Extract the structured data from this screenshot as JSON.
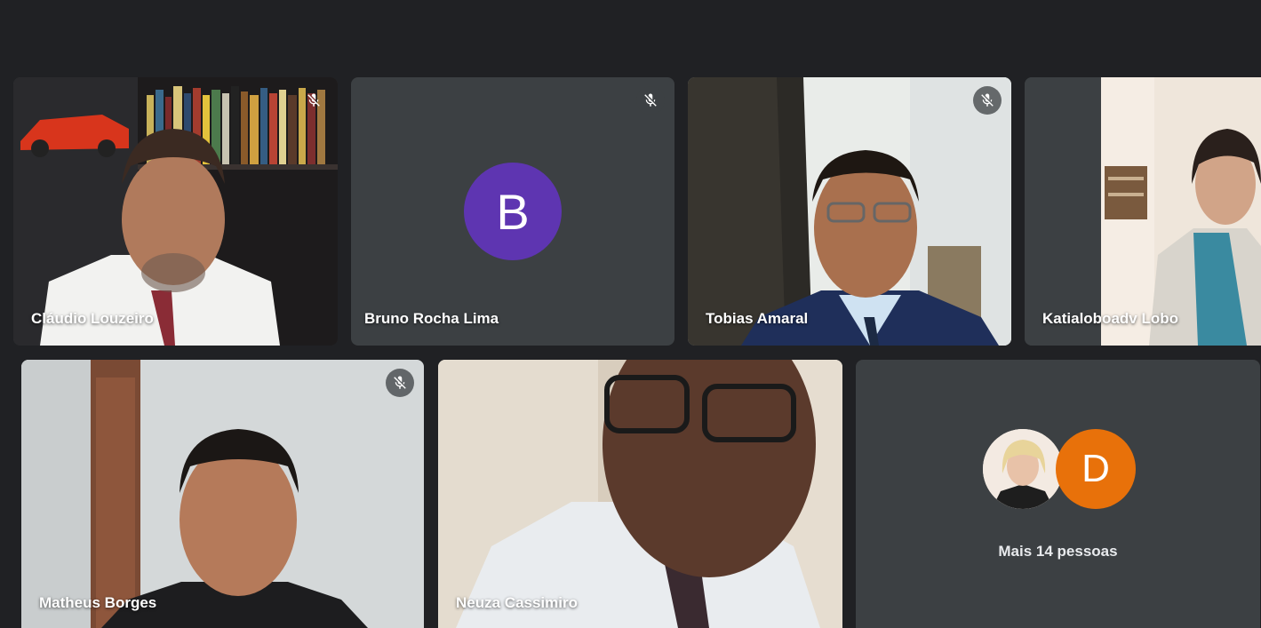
{
  "colors": {
    "background": "#202124",
    "tile": "#3c4043",
    "avatar_b": "#5e35b1",
    "avatar_d": "#e8710a"
  },
  "participants": [
    {
      "name": "Cláudio Louzeiro",
      "muted": true
    },
    {
      "name": "Bruno Rocha Lima",
      "muted": true,
      "avatar_letter": "B"
    },
    {
      "name": "Tobias Amaral",
      "muted": true
    },
    {
      "name": "Katialoboadv Lobo",
      "muted": false
    },
    {
      "name": "Matheus Borges",
      "muted": true
    },
    {
      "name": "Neuza Cassimiro",
      "muted": false
    }
  ],
  "more": {
    "label": "Mais 14 pessoas",
    "avatar_letter": "D"
  },
  "icons": {
    "mute": "mic-off-icon"
  }
}
